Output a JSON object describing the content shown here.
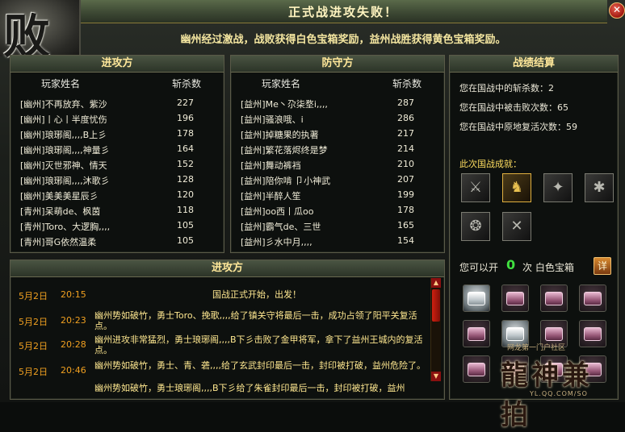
{
  "window": {
    "title": "正式战进攻失败！",
    "fail_char": "败",
    "close_symbol": "✕",
    "banner": "幽州经过激战，战败获得白色宝箱奖励，益州战胜获得黄色宝箱奖励。"
  },
  "attack_panel": {
    "title": "进攻方",
    "col_name": "玩家姓名",
    "col_kills": "斩杀数",
    "rows": [
      {
        "name": "[幽州]不再放弃、紫沙",
        "kills": "227"
      },
      {
        "name": "[幽州]丨心丨半度忧伤",
        "kills": "196"
      },
      {
        "name": "[幽州]琅琊阁,,,,B上彡",
        "kills": "178"
      },
      {
        "name": "[幽州]琅琊阁,,,,神量彡",
        "kills": "164"
      },
      {
        "name": "[幽州]灭世邪神、情天",
        "kills": "152"
      },
      {
        "name": "[幽州]琅琊阁,,,,沐歌彡",
        "kills": "128"
      },
      {
        "name": "[幽州]美美美星辰彡",
        "kills": "120"
      },
      {
        "name": "[青州]呆萌de、枫茵",
        "kills": "118"
      },
      {
        "name": "[青州]Toro、大逻胸,,,,",
        "kills": "105"
      },
      {
        "name": "[青州]哥G依然温柔",
        "kills": "105"
      }
    ]
  },
  "defense_panel": {
    "title": "防守方",
    "col_name": "玩家姓名",
    "col_kills": "斩杀数",
    "rows": [
      {
        "name": "[益州]Me丶尕柒堥i,,,,",
        "kills": "287"
      },
      {
        "name": "[益州]骚浪哦、i",
        "kills": "286"
      },
      {
        "name": "[益州]掉糖果的执著",
        "kills": "217"
      },
      {
        "name": "[益州]繁花落烬终是梦",
        "kills": "214"
      },
      {
        "name": "[益州]舞动裤裆",
        "kills": "210"
      },
      {
        "name": "[益州]陪你啃 卩小神武",
        "kills": "207"
      },
      {
        "name": "[益州]半醉人笙",
        "kills": "199"
      },
      {
        "name": "[益州]oo西丨瓜oo",
        "kills": "178"
      },
      {
        "name": "[益州]霸气de、三世",
        "kills": "165"
      },
      {
        "name": "[益州]彡水中月,,,,",
        "kills": "154"
      }
    ]
  },
  "summary": {
    "title": "战绩结算",
    "stat_kills": "您在国战中的斩杀数：2",
    "stat_defeated": "您在国战中被击败次数：65",
    "stat_revived": "您在国战中原地复活次数：59",
    "achievements_label": "此次国战成就：",
    "achievements": [
      "sword-icon",
      "golden-warrior-icon",
      "flame-icon",
      "beast-claw-icon",
      "bear-icon",
      "crossed-blades-icon"
    ],
    "open_prefix": "您可以开",
    "open_count": "0",
    "open_suffix": "次 白色宝箱",
    "detail_label": "详",
    "chests": [
      "white",
      "pink",
      "pink",
      "pink",
      "pink",
      "white",
      "pink",
      "pink",
      "pink",
      "pink",
      "pink",
      "pink"
    ]
  },
  "log_panel": {
    "title": "进攻方",
    "entries": [
      {
        "date": "5月2日",
        "time": "20:15",
        "msg": "国战正式开始，出发！"
      },
      {
        "date": "5月2日",
        "time": "20:23",
        "msg": "幽州势如破竹，勇士Toro、挽歌,,,,给了镇关守将最后一击，成功占领了阳平关复活点。"
      },
      {
        "date": "5月2日",
        "time": "20:28",
        "msg": "幽州进攻非常猛烈，勇士琅琊阁,,,,B下彡击败了金甲将军，拿下了益州王城内的复活点。"
      },
      {
        "date": "5月2日",
        "time": "20:46",
        "msg": "幽州势如破竹，勇士、青、砻,,,,给了玄武封印最后一击，封印被打破，益州危险了。"
      },
      {
        "date": "",
        "time": "",
        "msg": "幽州势如破竹，勇士琅琊阁,,,,B下彡给了朱雀封印最后一击，封印被打破，益州"
      }
    ]
  },
  "watermark": {
    "top": "网龙第一门户社区",
    "logo": "龍神兼拍",
    "url": "YL.QQ.COM/SO"
  }
}
